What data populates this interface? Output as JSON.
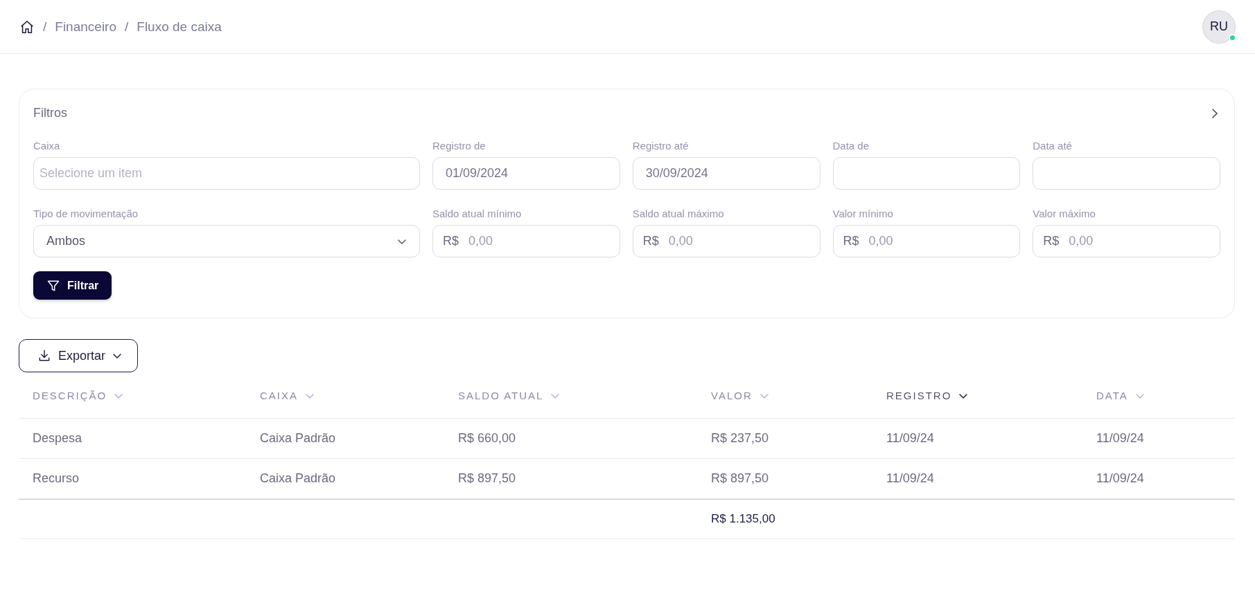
{
  "breadcrumb": {
    "items": [
      {
        "separator": "/",
        "label": "Financeiro"
      },
      {
        "separator": "/",
        "label": "Fluxo de caixa"
      }
    ]
  },
  "user": {
    "initials": "RU",
    "online": true
  },
  "filters": {
    "title": "Filtros",
    "expanded": false,
    "fields": [
      {
        "kind": "select",
        "label": "Caixa",
        "placeholder": "Selecione um item"
      },
      {
        "kind": "date",
        "label": "Registro de",
        "value": "01/09/2024"
      },
      {
        "kind": "date",
        "label": "Registro até",
        "value": "30/09/2024"
      },
      {
        "kind": "date",
        "label": "Data de"
      },
      {
        "kind": "date",
        "label": "Data até"
      },
      {
        "kind": "dropdown",
        "label": "Tipo de movimentação",
        "value": "Ambos"
      },
      {
        "kind": "money",
        "label": "Saldo atual mínimo",
        "prefix": "R$",
        "placeholder": "0,00"
      },
      {
        "kind": "money",
        "label": "Saldo atual máximo",
        "prefix": "R$",
        "placeholder": "0,00"
      },
      {
        "kind": "money",
        "label": "Valor mínimo",
        "prefix": "R$",
        "placeholder": "0,00"
      },
      {
        "kind": "money",
        "label": "Valor máximo",
        "prefix": "R$",
        "placeholder": "0,00"
      }
    ],
    "button": "Filtrar"
  },
  "export_button": "Exportar",
  "table": {
    "columns": [
      {
        "label": "DESCRIÇÃO",
        "sorted": false
      },
      {
        "label": "CAIXA",
        "sorted": false
      },
      {
        "label": "SALDO ATUAL",
        "sorted": false
      },
      {
        "label": "VALOR",
        "sorted": false
      },
      {
        "label": "REGISTRO",
        "sorted": true
      },
      {
        "label": "DATA",
        "sorted": false
      }
    ],
    "rows": [
      [
        "Despesa",
        "Caixa Padrão",
        "R$ 660,00",
        "R$ 237,50",
        "11/09/24",
        "11/09/24"
      ],
      [
        "Recurso",
        "Caixa Padrão",
        "R$ 897,50",
        "R$ 897,50",
        "11/09/24",
        "11/09/24"
      ]
    ],
    "total": "R$ 1.135,00"
  }
}
